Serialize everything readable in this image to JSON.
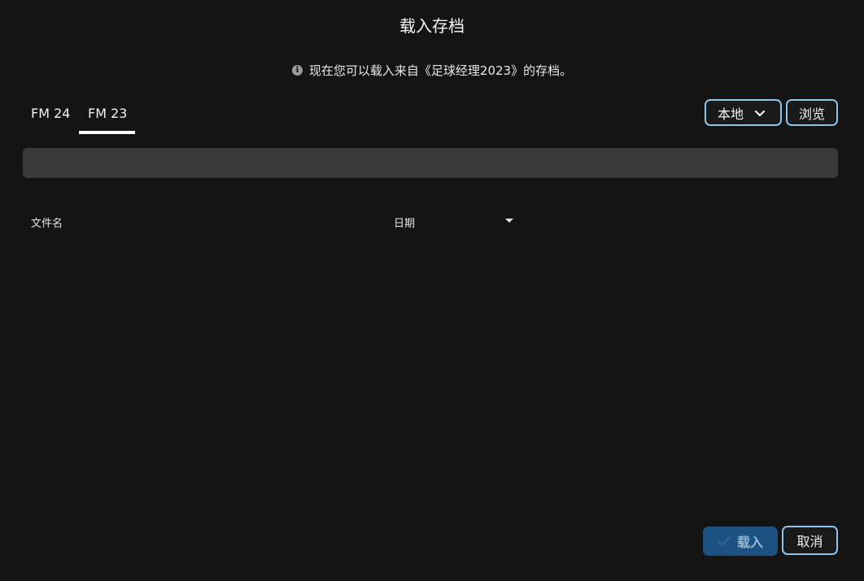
{
  "dialog": {
    "title": "载入存档",
    "info_text": "现在您可以载入来自《足球经理2023》的存档。"
  },
  "tabs": [
    {
      "label": "FM 24",
      "selected": false
    },
    {
      "label": "FM 23",
      "selected": true
    }
  ],
  "source": {
    "selected": "本地",
    "browse_label": "浏览"
  },
  "search": {
    "value": "",
    "placeholder": ""
  },
  "table": {
    "columns": [
      "文件名",
      "日期"
    ],
    "rows": []
  },
  "footer": {
    "load_label": "载入",
    "cancel_label": "取消"
  },
  "colors": {
    "background": "#141414",
    "accent_outline": "#8fc3ea",
    "primary_button": "#1c5282",
    "search_bar": "#3a3a3a"
  },
  "icons": [
    "info-icon",
    "chevron-down-icon",
    "sort-desc-icon",
    "check-icon"
  ]
}
